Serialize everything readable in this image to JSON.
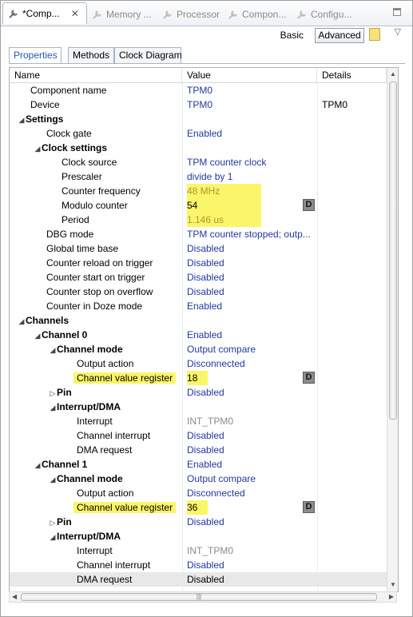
{
  "tabs": [
    {
      "label": "*Comp...",
      "active": true
    },
    {
      "label": "Memory ...",
      "active": false
    },
    {
      "label": "Processor",
      "active": false
    },
    {
      "label": "Compon...",
      "active": false
    },
    {
      "label": "Configu...",
      "active": false
    }
  ],
  "toolbar": {
    "basic_label": "Basic",
    "advanced_label": "Advanced"
  },
  "inner_tabs": [
    "Properties",
    "Methods",
    "Clock Diagram"
  ],
  "columns": [
    "Name",
    "Value",
    "Details"
  ],
  "rows": [
    {
      "name": "Component name",
      "value": "TPM0"
    },
    {
      "name": "Device",
      "value": "TPM0",
      "details": "TPM0"
    },
    {
      "name": "Settings",
      "value": ""
    },
    {
      "name": "Clock gate",
      "value": "Enabled"
    },
    {
      "name": "Clock settings",
      "value": ""
    },
    {
      "name": "Clock source",
      "value": "TPM counter clock"
    },
    {
      "name": "Prescaler",
      "value": "divide by 1"
    },
    {
      "name": "Counter frequency",
      "value": "48 MHz"
    },
    {
      "name": "Modulo counter",
      "value": "54"
    },
    {
      "name": "Period",
      "value": "1.146 us"
    },
    {
      "name": "DBG mode",
      "value": "TPM counter stopped; outp..."
    },
    {
      "name": "Global time base",
      "value": "Disabled"
    },
    {
      "name": "Counter reload on trigger",
      "value": "Disabled"
    },
    {
      "name": "Counter start on trigger",
      "value": "Disabled"
    },
    {
      "name": "Counter stop on overflow",
      "value": "Disabled"
    },
    {
      "name": "Counter in Doze mode",
      "value": "Enabled"
    },
    {
      "name": "Channels",
      "value": ""
    },
    {
      "name": "Channel 0",
      "value": "Enabled"
    },
    {
      "name": "Channel mode",
      "value": "Output compare"
    },
    {
      "name": "Output action",
      "value": "Disconnected"
    },
    {
      "name": "Channel value register",
      "value": "18"
    },
    {
      "name": "Pin",
      "value": "Disabled"
    },
    {
      "name": "Interrupt/DMA",
      "value": ""
    },
    {
      "name": "Interrupt",
      "value": "INT_TPM0"
    },
    {
      "name": "Channel interrupt",
      "value": "Disabled"
    },
    {
      "name": "DMA request",
      "value": "Disabled"
    },
    {
      "name": "Channel 1",
      "value": "Enabled"
    },
    {
      "name": "Channel mode",
      "value": "Output compare"
    },
    {
      "name": "Output action",
      "value": "Disconnected"
    },
    {
      "name": "Channel value register",
      "value": "36"
    },
    {
      "name": "Pin",
      "value": "Disabled"
    },
    {
      "name": "Interrupt/DMA",
      "value": ""
    },
    {
      "name": "Interrupt",
      "value": "INT_TPM0"
    },
    {
      "name": "Channel interrupt",
      "value": "Disabled"
    },
    {
      "name": "DMA request",
      "value": "Disabled"
    }
  ],
  "icons": {
    "detail_button": "D"
  },
  "colors": {
    "value_text": "#22389e",
    "highlight": "#fbf56a",
    "computed_value": "#a99a30"
  }
}
